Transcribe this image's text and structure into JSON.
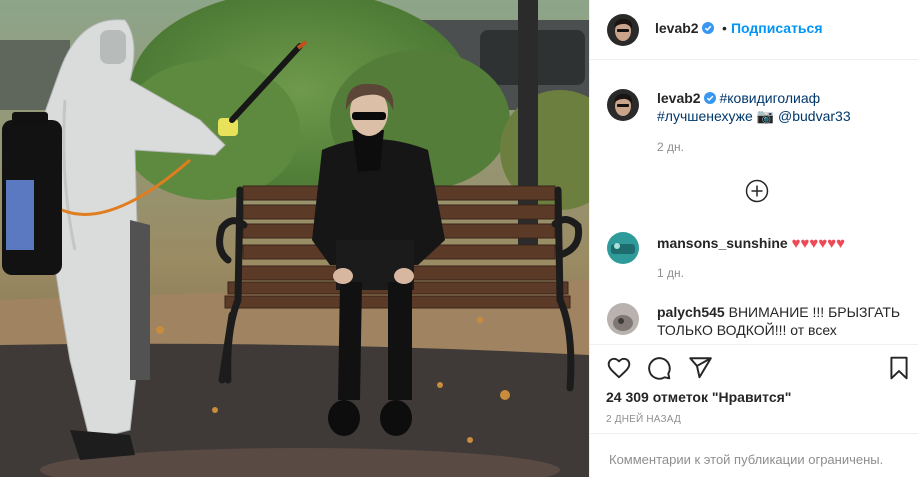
{
  "header": {
    "username": "levab2",
    "separator": "•",
    "follow_label": "Подписаться"
  },
  "caption": {
    "username": "levab2",
    "tag1": "#ковидиголиаф",
    "tag2": "#лучшенехуже",
    "camera": "📷",
    "mention": "@budvar33",
    "time": "2 дн."
  },
  "comments": [
    {
      "username": "mansons_sunshine",
      "text": "♥♥♥♥♥♥",
      "time": "1 дн."
    },
    {
      "username": "palych545",
      "text_line1": "ВНИМАНИЕ !!! БРЫЗГАТЬ",
      "text_line2": "ТОЛЬКО ВОДКОЙ!!! от всех"
    }
  ],
  "likes": {
    "count": "24 309",
    "label": "отметок \"Нравится\""
  },
  "post_time": "2 ДНЕЙ НАЗАД",
  "comments_limited": "Комментарии к этой публикации ограничены.",
  "colors": {
    "accent": "#0095f6",
    "verified": "#3897f0",
    "heart": "#ed4956"
  },
  "icons": [
    "heart-outline-icon",
    "comment-icon",
    "share-icon",
    "bookmark-icon",
    "add-comment-icon",
    "verified-icon"
  ]
}
